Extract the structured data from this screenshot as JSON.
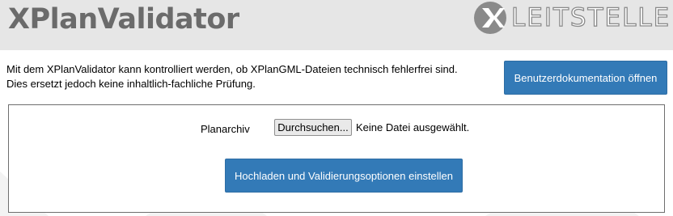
{
  "header": {
    "title": "XPlanValidator",
    "logo": {
      "icon": "x-logo-icon",
      "text": "LEITSTELLE"
    }
  },
  "intro": {
    "line1": "Mit dem XPlanValidator kann kontrolliert werden, ob XPlanGML-Dateien technisch fehlerfrei sind.",
    "line2": "Dies ersetzt jedoch keine inhaltlich-fachliche Prüfung."
  },
  "buttons": {
    "documentation": "Benutzerdokumentation öffnen",
    "upload": "Hochladen und Validierungsoptionen einstellen"
  },
  "upload_form": {
    "label": "Planarchiv",
    "browse_label": "Durchsuchen...",
    "file_status": "Keine Datei ausgewählt."
  },
  "colors": {
    "header_bg": "#e6e6e6",
    "title": "#6b6b6b",
    "primary_button": "#337ab7"
  }
}
